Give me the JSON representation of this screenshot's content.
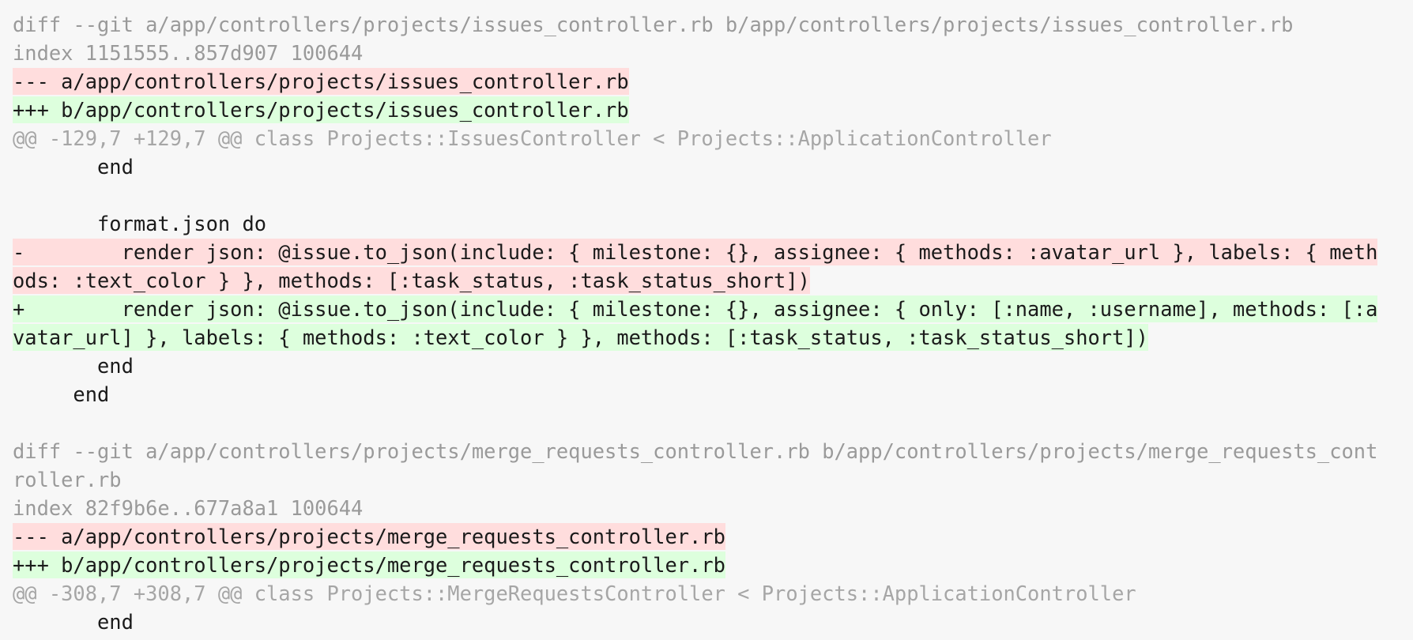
{
  "colors": {
    "background": "#f7f7f7",
    "meta_text": "#9a9a9a",
    "hunk_text": "#a6a6a6",
    "code_text": "#1a1a1a",
    "deletion_bg": "#ffdddd",
    "addition_bg": "#ddffdd"
  },
  "lines": [
    {
      "type": "meta",
      "text": "diff --git a/app/controllers/projects/issues_controller.rb b/app/controllers/projects/issues_controller.rb"
    },
    {
      "type": "meta",
      "text": "index 1151555..857d907 100644"
    },
    {
      "type": "del",
      "text": "--- a/app/controllers/projects/issues_controller.rb"
    },
    {
      "type": "add",
      "text": "+++ b/app/controllers/projects/issues_controller.rb"
    },
    {
      "type": "hunk",
      "text": "@@ -129,7 +129,7 @@ class Projects::IssuesController < Projects::ApplicationController"
    },
    {
      "type": "ctx",
      "text": "       end"
    },
    {
      "type": "ctx",
      "text": ""
    },
    {
      "type": "ctx",
      "text": "       format.json do"
    },
    {
      "type": "del",
      "text": "-        render json: @issue.to_json(include: { milestone: {}, assignee: { methods: :avatar_url }, labels: { meth"
    },
    {
      "type": "del",
      "text": "ods: :text_color } }, methods: [:task_status, :task_status_short])"
    },
    {
      "type": "add",
      "text": "+        render json: @issue.to_json(include: { milestone: {}, assignee: { only: [:name, :username], methods: [:a"
    },
    {
      "type": "add",
      "text": "vatar_url] }, labels: { methods: :text_color } }, methods: [:task_status, :task_status_short])"
    },
    {
      "type": "ctx",
      "text": "       end"
    },
    {
      "type": "ctx",
      "text": "     end"
    },
    {
      "type": "ctx",
      "text": ""
    },
    {
      "type": "meta",
      "text": "diff --git a/app/controllers/projects/merge_requests_controller.rb b/app/controllers/projects/merge_requests_cont"
    },
    {
      "type": "meta",
      "text": "roller.rb"
    },
    {
      "type": "meta",
      "text": "index 82f9b6e..677a8a1 100644"
    },
    {
      "type": "del",
      "text": "--- a/app/controllers/projects/merge_requests_controller.rb"
    },
    {
      "type": "add",
      "text": "+++ b/app/controllers/projects/merge_requests_controller.rb"
    },
    {
      "type": "hunk",
      "text": "@@ -308,7 +308,7 @@ class Projects::MergeRequestsController < Projects::ApplicationController"
    },
    {
      "type": "ctx",
      "text": "       end"
    }
  ]
}
